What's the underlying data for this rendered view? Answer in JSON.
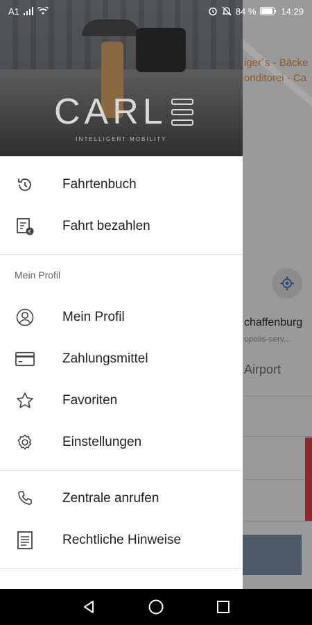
{
  "status_bar": {
    "carrier": "A1",
    "battery_percent": "84 %",
    "time": "14:29"
  },
  "brand": {
    "logo_text": "CARL",
    "tagline": "INTELLIGENT MOBILITY"
  },
  "menu": {
    "primary": [
      {
        "label": "Fahrtenbuch",
        "icon": "history-icon"
      },
      {
        "label": "Fahrt bezahlen",
        "icon": "receipt-pay-icon"
      }
    ],
    "profile_section_title": "Mein Profil",
    "profile": [
      {
        "label": "Mein Profil",
        "icon": "user-icon"
      },
      {
        "label": "Zahlungsmittel",
        "icon": "credit-card-icon"
      },
      {
        "label": "Favoriten",
        "icon": "star-icon"
      },
      {
        "label": "Einstellungen",
        "icon": "gear-icon"
      }
    ],
    "other": [
      {
        "label": "Zentrale anrufen",
        "icon": "phone-icon"
      },
      {
        "label": "Rechtliche Hinweise",
        "icon": "document-icon"
      }
    ]
  },
  "background_map": {
    "poi_line1": "iger´s - Bäcke",
    "poi_line2": "onditorei - Ca",
    "address": "chaffenburg",
    "address_sub": "opolis-serv...",
    "airport_label": "Airport"
  },
  "colors": {
    "drawer_bg": "#ffffff",
    "icon_color": "#424242",
    "text_color": "#212121"
  }
}
